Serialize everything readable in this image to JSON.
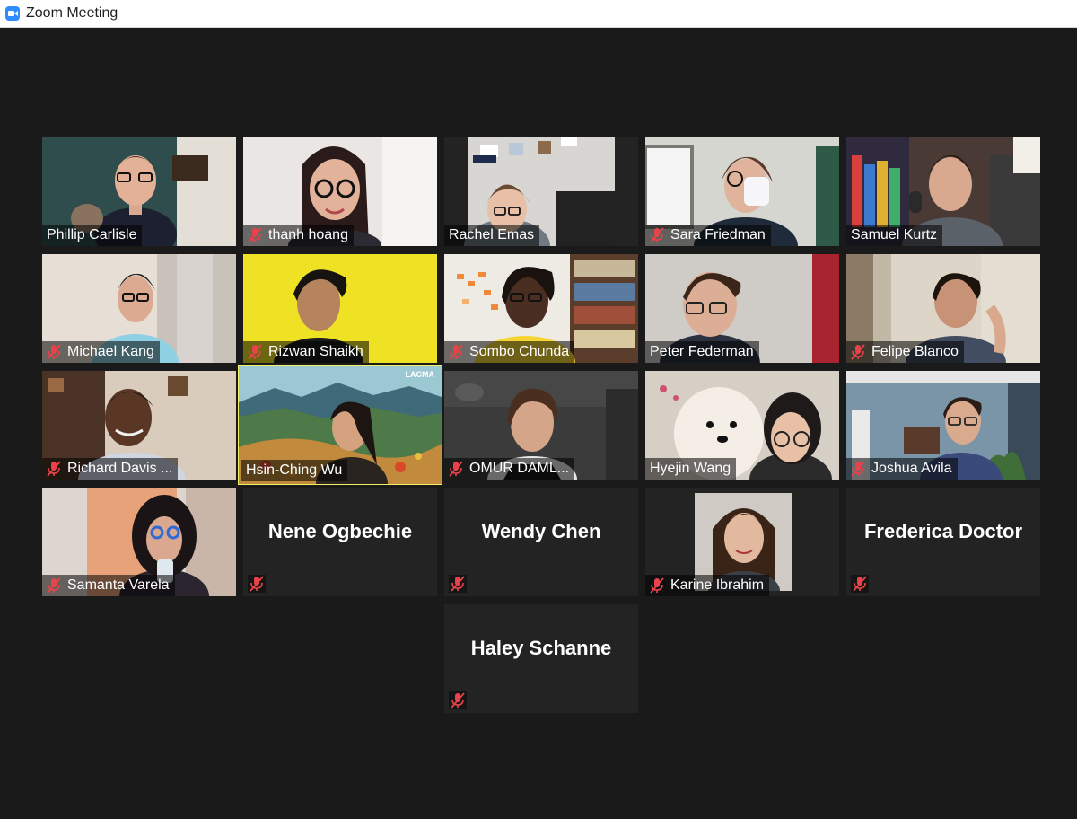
{
  "window": {
    "title": "Zoom Meeting"
  },
  "participants": [
    {
      "name": "Phillip Carlisle",
      "muted": false
    },
    {
      "name": "thanh hoang",
      "muted": true
    },
    {
      "name": "Rachel Emas",
      "muted": false
    },
    {
      "name": "Sara Friedman",
      "muted": true
    },
    {
      "name": "Samuel Kurtz",
      "muted": false
    },
    {
      "name": "Michael Kang",
      "muted": true
    },
    {
      "name": "Rizwan Shaikh",
      "muted": true
    },
    {
      "name": "Sombo Chunda",
      "muted": true
    },
    {
      "name": "Peter Federman",
      "muted": false
    },
    {
      "name": "Felipe Blanco",
      "muted": true
    },
    {
      "name": "Richard Davis ...",
      "muted": true
    },
    {
      "name": "Hsin-Ching Wu",
      "muted": false,
      "active_speaker": true,
      "background_watermark": "LACMA"
    },
    {
      "name": "OMUR DAML...",
      "muted": true
    },
    {
      "name": "Hyejin Wang",
      "muted": false
    },
    {
      "name": "Joshua Avila",
      "muted": true
    },
    {
      "name": "Samanta Varela",
      "muted": true
    },
    {
      "name": "Nene Ogbechie",
      "muted": true,
      "video_off": true
    },
    {
      "name": "Wendy Chen",
      "muted": true,
      "video_off": true
    },
    {
      "name": "Karine Ibrahim",
      "muted": true,
      "profile_photo": true
    },
    {
      "name": "Frederica Doctor",
      "muted": true,
      "video_off": true
    },
    {
      "name": "Haley Schanne",
      "muted": true,
      "video_off": true
    }
  ],
  "colors": {
    "active_speaker": "#f2f067",
    "muted_icon": "#e8434a",
    "brand": "#2d8cff"
  }
}
